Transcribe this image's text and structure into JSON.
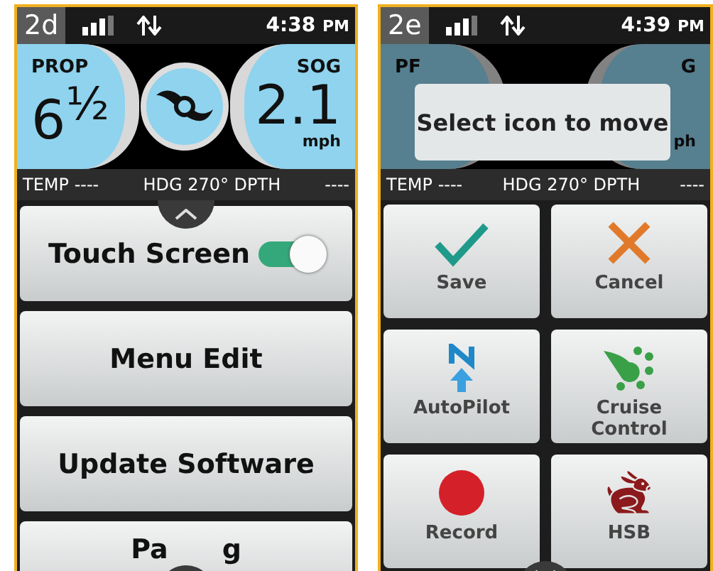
{
  "screens": [
    {
      "label": "2d",
      "time": "4:38",
      "ampm": "PM",
      "kind": "menu",
      "gauge": {
        "left_label": "PROP",
        "left_value": "6$^{½}$",
        "right_label": "SOG",
        "right_value": "2.1",
        "right_unit": "mph"
      },
      "info": {
        "temp": "TEMP ----",
        "heading": "HDG 270° DPTH",
        "depth": "----"
      },
      "menu": [
        {
          "kind": "toggle",
          "label": "Touch Screen",
          "on": true
        },
        {
          "kind": "plain",
          "label": "Menu Edit"
        },
        {
          "kind": "plain",
          "label": "Update Software"
        },
        {
          "kind": "covered",
          "label_parts": [
            "Pa",
            "g"
          ]
        }
      ]
    },
    {
      "label": "2e",
      "time": "4:39",
      "ampm": "PM",
      "kind": "grid",
      "gauge": {
        "left_label": "PF",
        "right_label": "G",
        "right_unit": "ph"
      },
      "popup": "Select icon to move",
      "info": {
        "temp": "TEMP ----",
        "heading": "HDG 270° DPTH",
        "depth": "----"
      },
      "tiles": [
        {
          "kind": "check",
          "label": "Save"
        },
        {
          "kind": "cross",
          "label": "Cancel"
        },
        {
          "kind": "north",
          "label": "AutoPilot"
        },
        {
          "kind": "cruise",
          "label": "Cruise Control"
        },
        {
          "kind": "record",
          "label": "Record"
        },
        {
          "kind": "rabbit",
          "label": "HSB"
        }
      ]
    }
  ]
}
